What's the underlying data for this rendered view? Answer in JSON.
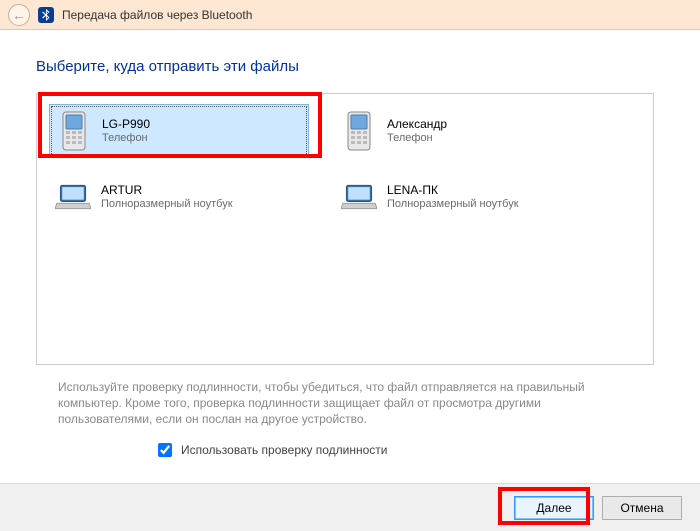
{
  "window": {
    "title": "Передача файлов через Bluetooth"
  },
  "heading": "Выберите, куда отправить эти файлы",
  "devices": [
    {
      "name": "LG-P990",
      "type": "Телефон",
      "icon": "phone",
      "selected": true
    },
    {
      "name": "Александр",
      "type": "Телефон",
      "icon": "phone",
      "selected": false
    },
    {
      "name": "ARTUR",
      "type": "Полноразмерный ноутбук",
      "icon": "laptop",
      "selected": false
    },
    {
      "name": "LENA-ПК",
      "type": "Полноразмерный ноутбук",
      "icon": "laptop",
      "selected": false
    }
  ],
  "hint": "Используйте проверку подлинности, чтобы убедиться, что файл отправляется на правильный компьютер. Кроме того, проверка подлинности защищает файл от просмотра другими пользователями, если он послан на другое устройство.",
  "auth": {
    "label": "Использовать проверку подлинности",
    "checked": true
  },
  "buttons": {
    "next": "Далее",
    "cancel": "Отмена"
  }
}
